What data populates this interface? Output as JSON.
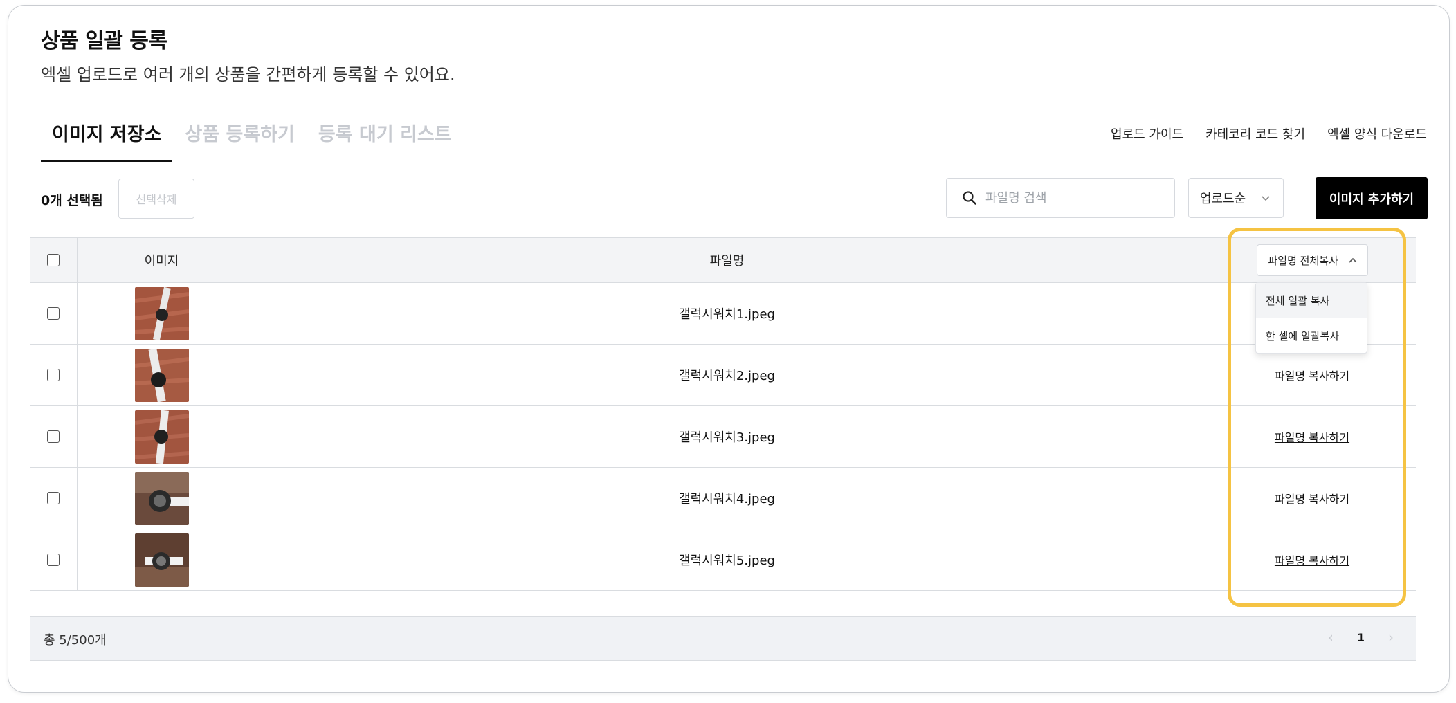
{
  "header": {
    "title": "상품 일괄 등록",
    "subtitle": "엑셀 업로드로 여러 개의 상품을 간편하게 등록할 수 있어요."
  },
  "tabs": [
    {
      "label": "이미지 저장소",
      "active": true
    },
    {
      "label": "상품 등록하기",
      "active": false
    },
    {
      "label": "등록 대기 리스트",
      "active": false
    }
  ],
  "help_links": [
    "업로드 가이드",
    "카테코리 코드 찾기",
    "엑셀 양식 다운로드"
  ],
  "toolbar": {
    "selected_count": "0개 선택됨",
    "delete_selected": "선택삭제",
    "search_placeholder": "파일명 검색",
    "sort_value": "업로드순",
    "add_image": "이미지 추가하기"
  },
  "table": {
    "headers": {
      "image": "이미지",
      "filename": "파일명"
    },
    "copy_all_button": "파일명 전체복사",
    "dropdown_options": [
      "전체 일괄 복사",
      "한 셀에 일괄복사"
    ],
    "copy_link_label": "파일명 복사하기",
    "rows": [
      {
        "filename": "갤럭시워치1.jpeg"
      },
      {
        "filename": "갤럭시워치2.jpeg"
      },
      {
        "filename": "갤럭시워치3.jpeg"
      },
      {
        "filename": "갤럭시워치4.jpeg"
      },
      {
        "filename": "갤럭시워치5.jpeg"
      }
    ]
  },
  "footer": {
    "total": "총 5/500개",
    "current_page": "1"
  },
  "colors": {
    "accent_highlight": "#f5c343",
    "primary_button": "#000000",
    "header_bg": "#f3f4f6"
  }
}
